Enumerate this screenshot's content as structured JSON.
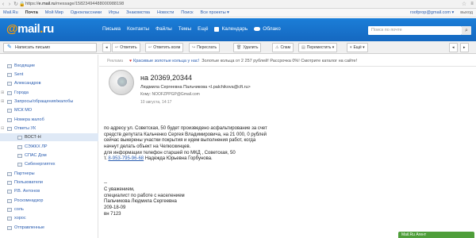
{
  "browser": {
    "url_prefix": "https://",
    "url_host": "e.mail.ru",
    "url_path": "/message/15823494488000988198"
  },
  "portal": {
    "links": [
      "Mail.Ru",
      "Почта",
      "Мой Мир",
      "Одноклассники",
      "Игры",
      "Знакомства",
      "Новости",
      "Поиск"
    ],
    "projects_label": "Все проекты ▾",
    "user_email": "roofprop@gmail.com ▾",
    "logout": "выход"
  },
  "header": {
    "logo_at": "@",
    "logo_text": "mail",
    "logo_dot": ".",
    "logo_tld": "ru",
    "nav": [
      "Письма",
      "Контакты",
      "Файлы",
      "Темы",
      "Ещё"
    ],
    "calendar": "Календарь",
    "cloud": "Облако",
    "search_placeholder": "Поиск по почте"
  },
  "toolbar": {
    "compose": "Написать письмо",
    "back": "◂",
    "reply": "Ответить",
    "reply_all": "Ответить всем",
    "forward": "Переслать",
    "delete": "Удалить",
    "spam": "Спам",
    "move": "Переместить",
    "more": "Ещё",
    "prev": "◂",
    "next": "▸"
  },
  "folders": [
    {
      "label": "Входящие",
      "indent": 0
    },
    {
      "label": "Sent",
      "indent": 0
    },
    {
      "label": "Александров",
      "indent": 0
    },
    {
      "label": "Города",
      "indent": 0,
      "toggle": "⊞"
    },
    {
      "label": "Запросы/обращения/жалобы",
      "indent": 0,
      "toggle": "⊞"
    },
    {
      "label": "МСК МО",
      "indent": 0
    },
    {
      "label": "Номера жалоб",
      "indent": 0
    },
    {
      "label": "Ответы УК",
      "indent": 0,
      "toggle": "⊟"
    },
    {
      "label": "ВОСТ-Н",
      "indent": 1,
      "selected": true
    },
    {
      "label": "СЭЖКХ ЛР",
      "indent": 1
    },
    {
      "label": "СПАС Дом",
      "indent": 1
    },
    {
      "label": "Сибенергиятех",
      "indent": 1
    },
    {
      "label": "Партнеры",
      "indent": 0
    },
    {
      "label": "Пользователи",
      "indent": 0
    },
    {
      "label": "Р.В. Антонов",
      "indent": 0
    },
    {
      "label": "Роскомнадзор",
      "indent": 0
    },
    {
      "label": "соль",
      "indent": 0
    },
    {
      "label": "хорос",
      "indent": 0
    },
    {
      "label": "Отправленные",
      "indent": 0
    }
  ],
  "ad": {
    "label": "Реклама",
    "icon": "♥",
    "link": "Красивые золотые кольца у нас!",
    "text": "Золотые кольца от 2 257 рублей! Рассрочка 0%! Смотрите каталог на сайте!"
  },
  "message": {
    "subject": "на 20369,20344",
    "sender": "Людмила Сергеевна Пальчикова <l.palchikova@cft.ru>",
    "to": "Кому: NOOFZPPGP@Gmail.com",
    "date": "10 августа, 14:17",
    "body": [
      "по адресу ул. Советская, 50 будет произведено асфальтирование за счет",
      "средств депутата Кальченко Сергея Владимировича, на 21 000, 0 рублей",
      "сейчас выкерены участки покрытия и идем выполнения работ, когда",
      "начнут делать объект на Челюскинцев.",
      "для информации телефон старшей по МКД , Советская, 50",
      "т. |8-953-795-96-68| Надежда Юрьевна Горбунова.",
      "",
      "",
      "",
      "--",
      "С уважением,",
      "специалист по работе с населением",
      "Пальчикова Людмила Сергеевна",
      "209-18-09",
      "вн 7123"
    ]
  },
  "agent": {
    "label": "Mail.Ru Агент"
  }
}
